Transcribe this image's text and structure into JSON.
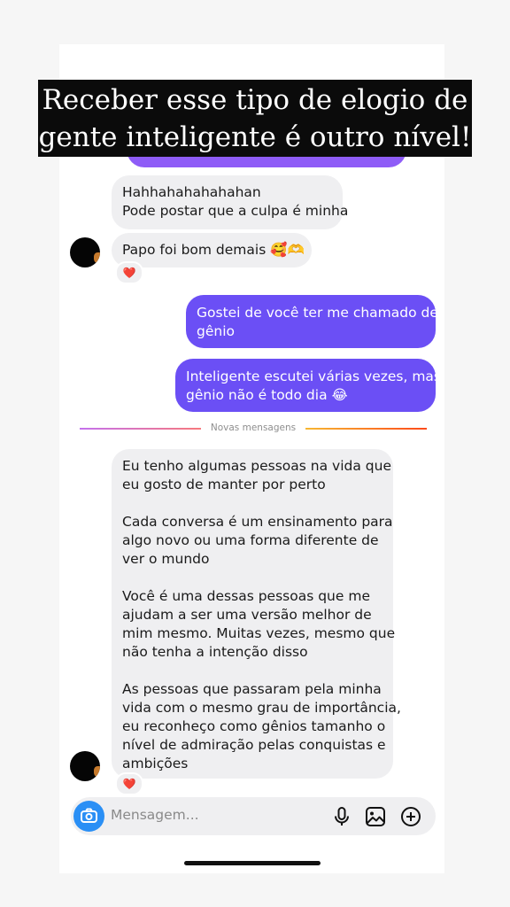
{
  "caption": {
    "line1": "Receber esse tipo de elogio de",
    "line2": "gente inteligente é outro nível!"
  },
  "messages": [
    {
      "id": "m1",
      "direction": "incoming",
      "lines": [
        "Hahhahahahahahan",
        "Pode postar que a culpa é minha"
      ]
    },
    {
      "id": "m2",
      "direction": "incoming",
      "text": "Papo foi bom demais",
      "emoji": "🥰🫶",
      "reaction": "❤️"
    },
    {
      "id": "m3",
      "direction": "outgoing",
      "lines": [
        "Gostei de você ter me chamado de",
        "gênio"
      ]
    },
    {
      "id": "m4",
      "direction": "outgoing",
      "lines": [
        "Inteligente escutei várias vezes, mas",
        "gênio não é todo dia 😂"
      ]
    },
    {
      "id": "m5",
      "direction": "incoming",
      "paragraphs": [
        [
          "Eu tenho algumas pessoas na vida que",
          "eu gosto de manter por perto"
        ],
        [
          "Cada conversa é um ensinamento para",
          "algo novo ou uma forma diferente de",
          "ver o mundo"
        ],
        [
          "Você é uma dessas pessoas que me",
          "ajudam a ser uma versão melhor de",
          "mim mesmo. Muitas vezes, mesmo que",
          "não tenha a intenção disso"
        ],
        [
          "As pessoas que passaram pela minha",
          "vida com o mesmo grau de importância,",
          "eu reconheço como gênios tamanho o",
          "nível de admiração pelas conquistas e",
          "ambições"
        ]
      ],
      "reaction": "❤️"
    }
  ],
  "divider": {
    "label": "Novas mensagens"
  },
  "composer": {
    "placeholder": "Mensagem...",
    "icons": [
      "camera-icon",
      "microphone-icon",
      "gallery-icon",
      "plus-circle-icon"
    ]
  },
  "colors": {
    "outgoing_bubble": "#6b4ff5",
    "incoming_bubble": "#efeff1",
    "camera_button": "#2a8ff5",
    "reaction_heart": "#e0245e"
  }
}
